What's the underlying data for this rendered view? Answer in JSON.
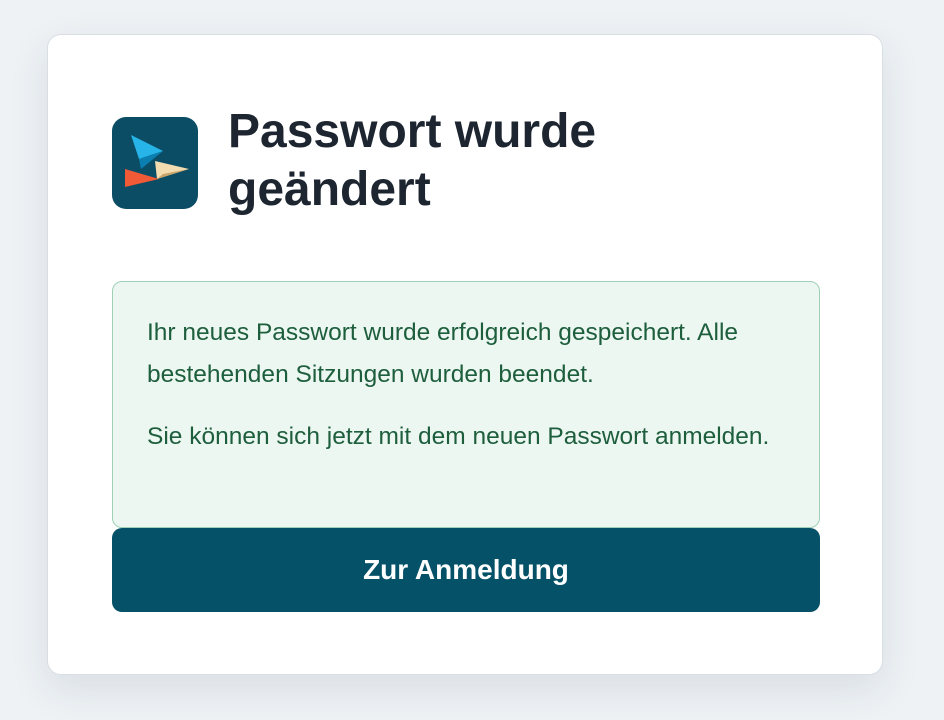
{
  "card": {
    "title": "Passwort wurde geändert",
    "logo_icon": "paper-planes-logo-icon"
  },
  "notice": {
    "line_1": "Ihr neues Passwort wurde erfolgreich gespeichert. Alle bestehenden Sitzungen wurden beendet.",
    "line_2": "Sie können sich jetzt mit dem neuen Passwort anmelden."
  },
  "actions": {
    "login_button_label": "Zur Anmeldung"
  },
  "colors": {
    "accent": "#045168",
    "success_text": "#1d5e3d",
    "success_bg": "#edf7f1",
    "success_border": "#9fd0b7"
  }
}
